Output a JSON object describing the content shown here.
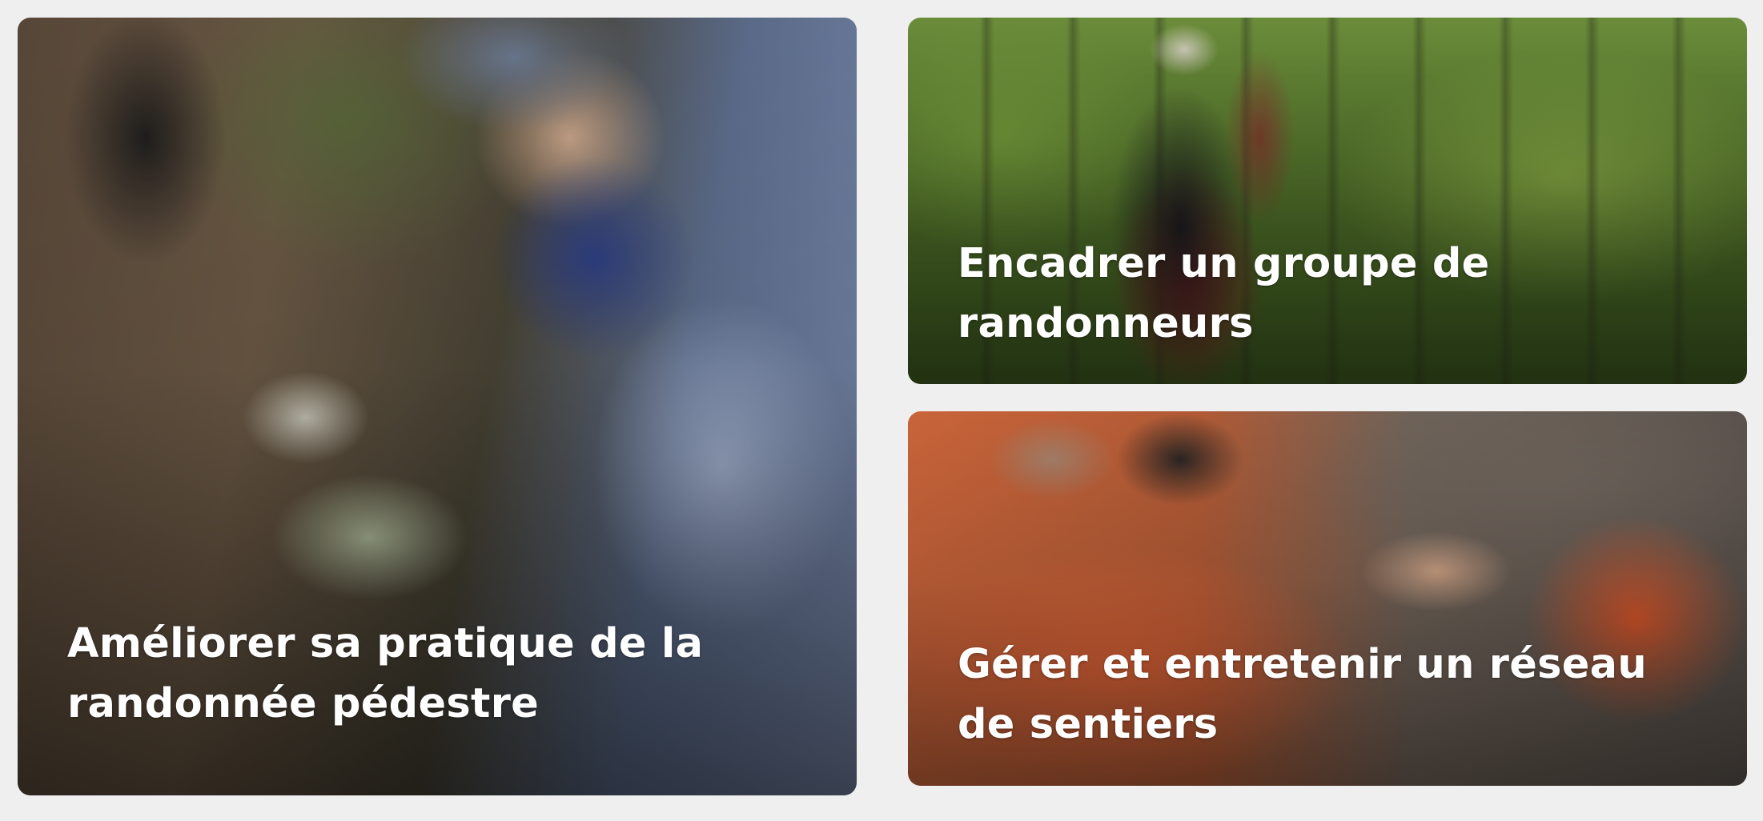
{
  "cards": [
    {
      "title": "Améliorer sa pratique de la randonnée pédestre"
    },
    {
      "title": "Encadrer un groupe de randonneurs"
    },
    {
      "title": "Gérer et entretenir un réseau de sentiers"
    }
  ]
}
